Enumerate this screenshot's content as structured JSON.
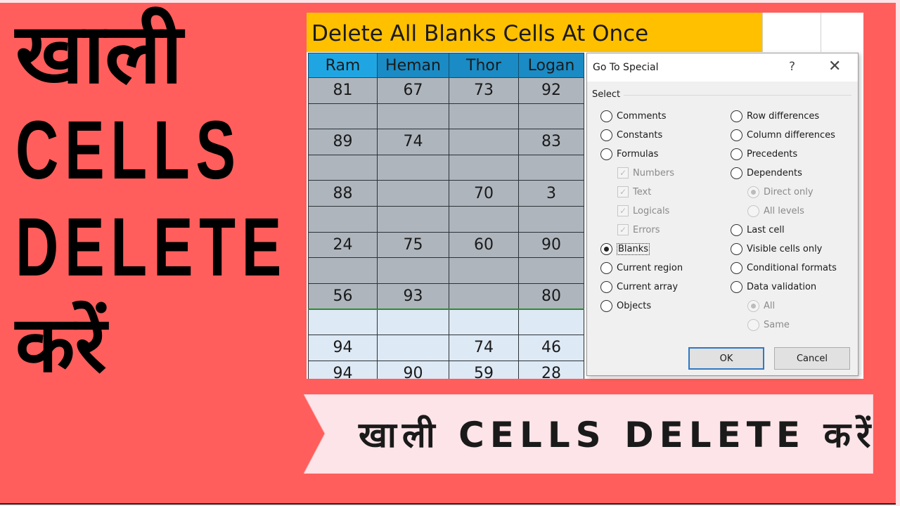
{
  "thumbnail": {
    "headline": {
      "line1": "खाली",
      "line2": "CELLS",
      "line3": "DELETE",
      "line4": "करें"
    },
    "banner_text": "खाली CELLS DELETE करें",
    "colors": {
      "background": "#ff5e5c",
      "banner": "#fde4e8",
      "title_fill": "#ffc000",
      "header_fill": "#1a8bc4",
      "selected_fill": "#aeb5bd",
      "unselected_fill": "#dde9f5"
    }
  },
  "spreadsheet": {
    "title": "Delete All Blanks Cells At Once",
    "columns": [
      "Ram",
      "Heman",
      "Thor",
      "Logan"
    ],
    "rows": [
      {
        "cells": [
          "81",
          "67",
          "73",
          "92"
        ],
        "selected": true
      },
      {
        "cells": [
          "",
          "",
          "",
          ""
        ],
        "selected": true
      },
      {
        "cells": [
          "89",
          "74",
          "",
          "83"
        ],
        "selected": true
      },
      {
        "cells": [
          "",
          "",
          "",
          ""
        ],
        "selected": true
      },
      {
        "cells": [
          "88",
          "",
          "70",
          "3"
        ],
        "selected": true
      },
      {
        "cells": [
          "",
          "",
          "",
          ""
        ],
        "selected": true
      },
      {
        "cells": [
          "24",
          "75",
          "60",
          "90"
        ],
        "selected": true
      },
      {
        "cells": [
          "",
          "",
          "",
          ""
        ],
        "selected": true
      },
      {
        "cells": [
          "56",
          "93",
          "",
          "80"
        ],
        "selected": true
      },
      {
        "cells": [
          "",
          "",
          "",
          ""
        ],
        "selected": false
      },
      {
        "cells": [
          "94",
          "",
          "74",
          "46"
        ],
        "selected": false
      },
      {
        "cells": [
          "94",
          "90",
          "59",
          "28"
        ],
        "selected": false
      }
    ]
  },
  "dialog": {
    "title": "Go To Special",
    "help_label": "?",
    "close_label": "✕",
    "group_label": "Select",
    "left_options": [
      {
        "label": "Comments",
        "type": "radio",
        "checked": false,
        "disabled": false
      },
      {
        "label": "Constants",
        "type": "radio",
        "checked": false,
        "disabled": false
      },
      {
        "label": "Formulas",
        "type": "radio",
        "checked": false,
        "disabled": false
      },
      {
        "label": "Numbers",
        "type": "checkbox",
        "checked": true,
        "disabled": true
      },
      {
        "label": "Text",
        "type": "checkbox",
        "checked": true,
        "disabled": true
      },
      {
        "label": "Logicals",
        "type": "checkbox",
        "checked": true,
        "disabled": true
      },
      {
        "label": "Errors",
        "type": "checkbox",
        "checked": true,
        "disabled": true
      },
      {
        "label": "Blanks",
        "type": "radio",
        "checked": true,
        "disabled": false
      },
      {
        "label": "Current region",
        "type": "radio",
        "checked": false,
        "disabled": false
      },
      {
        "label": "Current array",
        "type": "radio",
        "checked": false,
        "disabled": false
      },
      {
        "label": "Objects",
        "type": "radio",
        "checked": false,
        "disabled": false
      }
    ],
    "right_options": [
      {
        "label": "Row differences",
        "type": "radio",
        "checked": false,
        "disabled": false
      },
      {
        "label": "Column differences",
        "type": "radio",
        "checked": false,
        "disabled": false
      },
      {
        "label": "Precedents",
        "type": "radio",
        "checked": false,
        "disabled": false
      },
      {
        "label": "Dependents",
        "type": "radio",
        "checked": false,
        "disabled": false
      },
      {
        "label": "Direct only",
        "type": "radio",
        "checked": true,
        "disabled": true
      },
      {
        "label": "All levels",
        "type": "radio",
        "checked": false,
        "disabled": true
      },
      {
        "label": "Last cell",
        "type": "radio",
        "checked": false,
        "disabled": false
      },
      {
        "label": "Visible cells only",
        "type": "radio",
        "checked": false,
        "disabled": false
      },
      {
        "label": "Conditional formats",
        "type": "radio",
        "checked": false,
        "disabled": false
      },
      {
        "label": "Data validation",
        "type": "radio",
        "checked": false,
        "disabled": false
      },
      {
        "label": "All",
        "type": "radio",
        "checked": true,
        "disabled": true
      },
      {
        "label": "Same",
        "type": "radio",
        "checked": false,
        "disabled": true
      }
    ],
    "ok_label": "OK",
    "cancel_label": "Cancel"
  }
}
